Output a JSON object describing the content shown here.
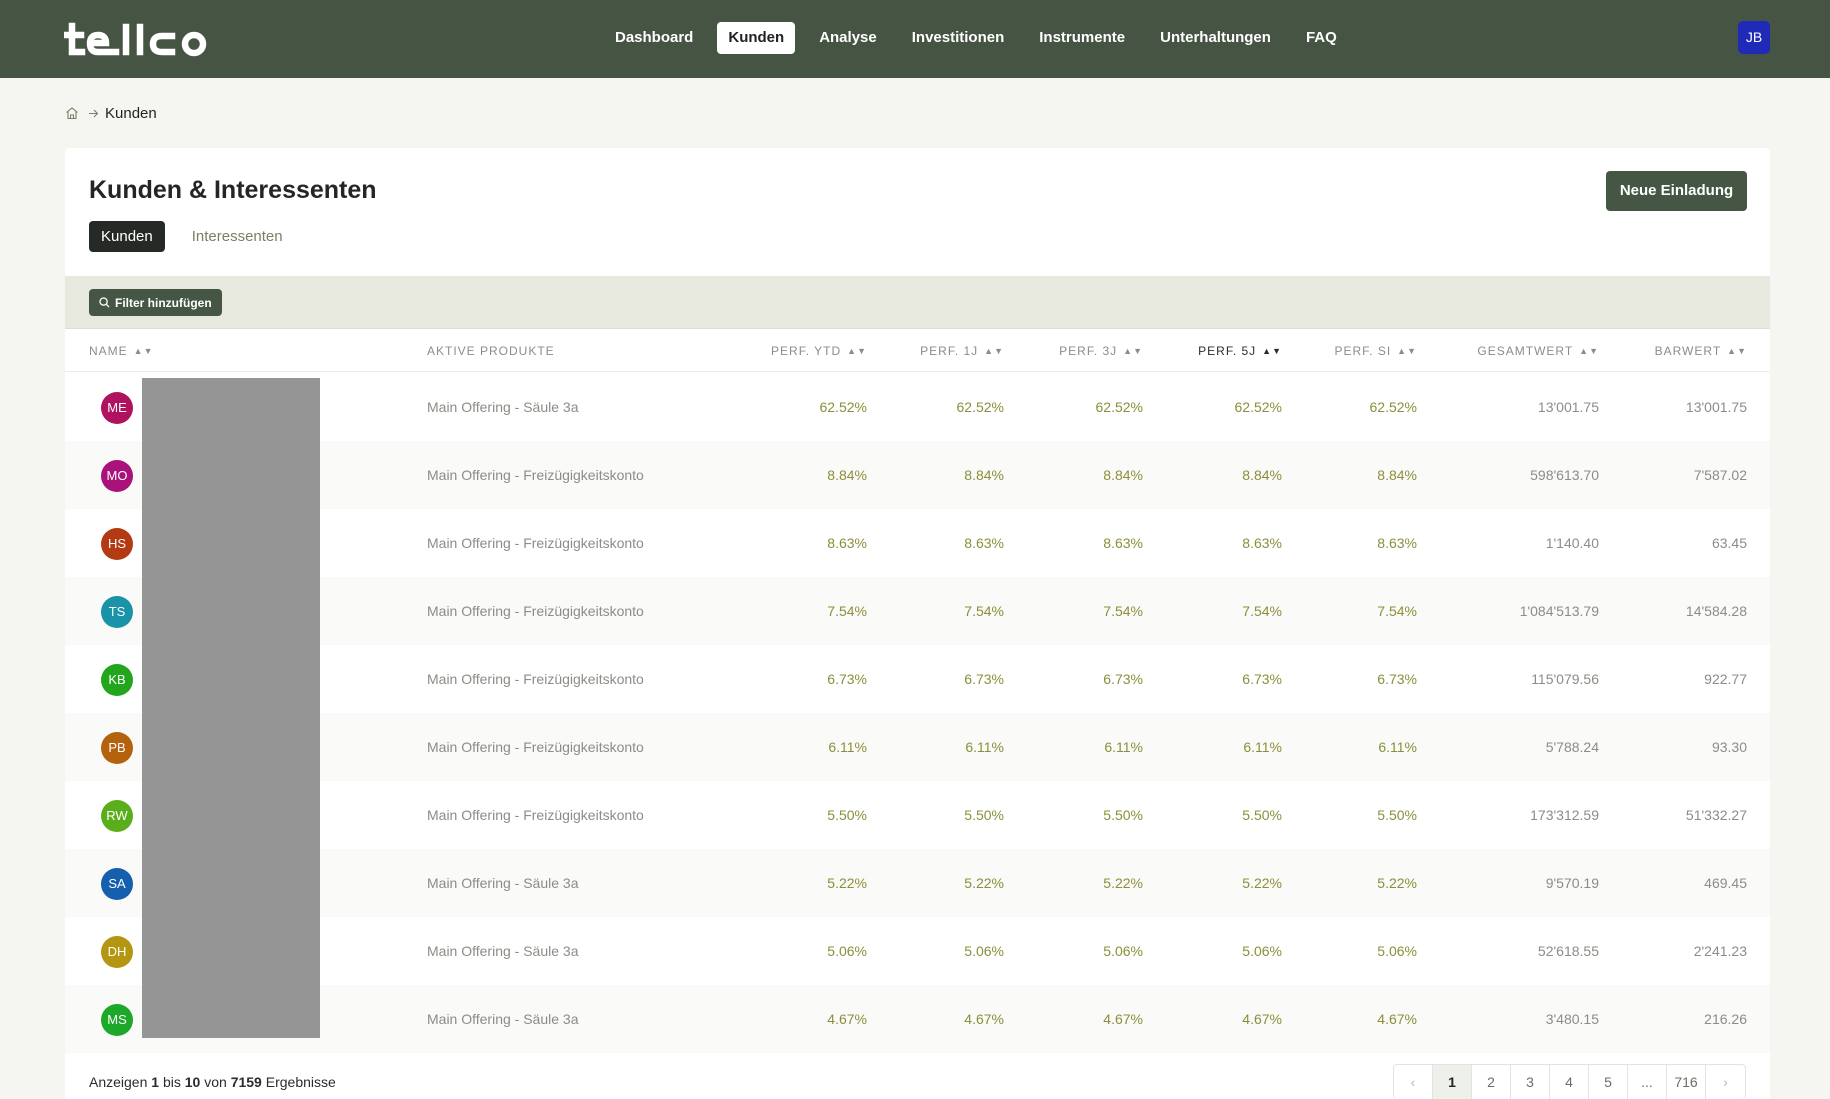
{
  "brand": {
    "logo_text": "tellco"
  },
  "nav": {
    "items": [
      {
        "label": "Dashboard",
        "active": false
      },
      {
        "label": "Kunden",
        "active": true
      },
      {
        "label": "Analyse",
        "active": false
      },
      {
        "label": "Investitionen",
        "active": false
      },
      {
        "label": "Instrumente",
        "active": false
      },
      {
        "label": "Unterhaltungen",
        "active": false
      },
      {
        "label": "FAQ",
        "active": false
      }
    ],
    "user_initials": "JB"
  },
  "breadcrumb": {
    "icon": "home-icon",
    "current": "Kunden"
  },
  "page": {
    "title": "Kunden & Interessenten",
    "cta_label": "Neue Einladung",
    "tabs": [
      {
        "label": "Kunden",
        "active": true
      },
      {
        "label": "Interessenten",
        "active": false
      }
    ],
    "filter_label": "Filter hinzufügen"
  },
  "table": {
    "columns": [
      {
        "key": "name",
        "label": "NAME",
        "sortable": true
      },
      {
        "key": "products",
        "label": "AKTIVE PRODUKTE",
        "sortable": false
      },
      {
        "key": "ytd",
        "label": "PERF. YTD",
        "sortable": true
      },
      {
        "key": "p1",
        "label": "PERF. 1J",
        "sortable": true
      },
      {
        "key": "p3",
        "label": "PERF. 3J",
        "sortable": true
      },
      {
        "key": "p5",
        "label": "PERF. 5J",
        "sortable": true
      },
      {
        "key": "si",
        "label": "PERF. SI",
        "sortable": true
      },
      {
        "key": "total",
        "label": "GESAMTWERT",
        "sortable": true
      },
      {
        "key": "cash",
        "label": "BARWERT",
        "sortable": true
      }
    ],
    "rows": [
      {
        "initials": "ME",
        "color": "#b0125f",
        "products": "Main Offering - Säule 3a",
        "ytd": "62.52%",
        "p1": "62.52%",
        "p3": "62.52%",
        "p5": "62.52%",
        "si": "62.52%",
        "total": "13'001.75",
        "cash": "13'001.75"
      },
      {
        "initials": "MO",
        "color": "#a8127a",
        "products": "Main Offering - Freizügigkeitskonto",
        "ytd": "8.84%",
        "p1": "8.84%",
        "p3": "8.84%",
        "p5": "8.84%",
        "si": "8.84%",
        "total": "598'613.70",
        "cash": "7'587.02"
      },
      {
        "initials": "HS",
        "color": "#b33a12",
        "products": "Main Offering - Freizügigkeitskonto",
        "ytd": "8.63%",
        "p1": "8.63%",
        "p3": "8.63%",
        "p5": "8.63%",
        "si": "8.63%",
        "total": "1'140.40",
        "cash": "63.45"
      },
      {
        "initials": "TS",
        "color": "#1a93a8",
        "products": "Main Offering - Freizügigkeitskonto",
        "ytd": "7.54%",
        "p1": "7.54%",
        "p3": "7.54%",
        "p5": "7.54%",
        "si": "7.54%",
        "total": "1'084'513.79",
        "cash": "14'584.28"
      },
      {
        "initials": "KB",
        "color": "#23a51e",
        "products": "Main Offering - Freizügigkeitskonto",
        "ytd": "6.73%",
        "p1": "6.73%",
        "p3": "6.73%",
        "p5": "6.73%",
        "si": "6.73%",
        "total": "115'079.56",
        "cash": "922.77"
      },
      {
        "initials": "PB",
        "color": "#b5620f",
        "products": "Main Offering - Freizügigkeitskonto",
        "ytd": "6.11%",
        "p1": "6.11%",
        "p3": "6.11%",
        "p5": "6.11%",
        "si": "6.11%",
        "total": "5'788.24",
        "cash": "93.30"
      },
      {
        "initials": "RW",
        "color": "#5aae1c",
        "products": "Main Offering - Freizügigkeitskonto",
        "ytd": "5.50%",
        "p1": "5.50%",
        "p3": "5.50%",
        "p5": "5.50%",
        "si": "5.50%",
        "total": "173'312.59",
        "cash": "51'332.27"
      },
      {
        "initials": "SA",
        "color": "#155fae",
        "products": "Main Offering - Säule 3a",
        "ytd": "5.22%",
        "p1": "5.22%",
        "p3": "5.22%",
        "p5": "5.22%",
        "si": "5.22%",
        "total": "9'570.19",
        "cash": "469.45"
      },
      {
        "initials": "DH",
        "color": "#b39612",
        "products": "Main Offering - Säule 3a",
        "ytd": "5.06%",
        "p1": "5.06%",
        "p3": "5.06%",
        "p5": "5.06%",
        "si": "5.06%",
        "total": "52'618.55",
        "cash": "2'241.23"
      },
      {
        "initials": "MS",
        "color": "#1ea82a",
        "products": "Main Offering - Säule 3a",
        "ytd": "4.67%",
        "p1": "4.67%",
        "p3": "4.67%",
        "p5": "4.67%",
        "si": "4.67%",
        "total": "3'480.15",
        "cash": "216.26"
      }
    ]
  },
  "footer": {
    "prefix": "Anzeigen",
    "from": "1",
    "mid1": "bis",
    "to": "10",
    "mid2": "von",
    "total": "7159",
    "suffix": "Ergebnisse",
    "pages": [
      "1",
      "2",
      "3",
      "4",
      "5",
      "...",
      "716"
    ],
    "active_page": "1"
  }
}
